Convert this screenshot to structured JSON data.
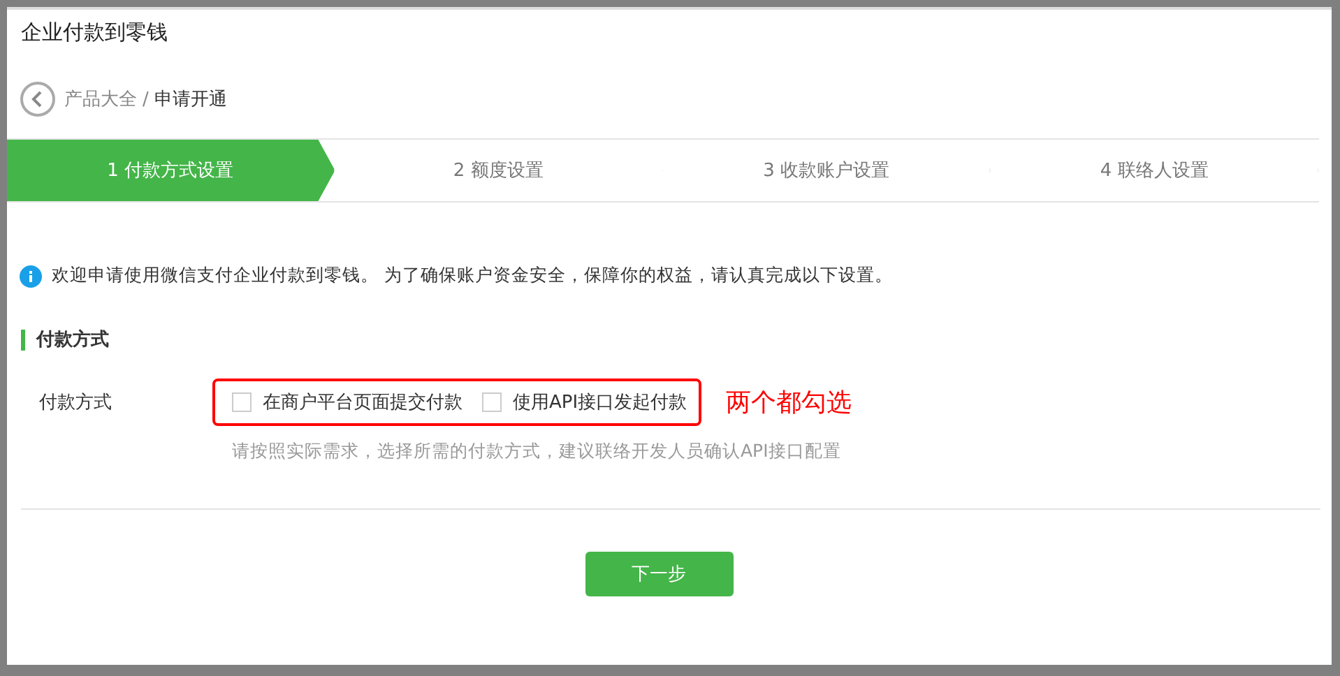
{
  "dialog": {
    "title": "企业付款到零钱"
  },
  "breadcrumb": {
    "parent": "产品大全",
    "separator": "/",
    "current": "申请开通"
  },
  "steps": [
    {
      "label": "1 付款方式设置",
      "selected": true
    },
    {
      "label": "2 额度设置",
      "selected": false
    },
    {
      "label": "3 收款账户设置",
      "selected": false
    },
    {
      "label": "4 联络人设置",
      "selected": false
    }
  ],
  "notice": "欢迎申请使用微信支付企业付款到零钱。 为了确保账户资金安全，保障你的权益，请认真完成以下设置。",
  "section": {
    "title": "付款方式"
  },
  "field": {
    "label": "付款方式",
    "options": [
      {
        "label": "在商户平台页面提交付款",
        "checked": false
      },
      {
        "label": "使用API接口发起付款",
        "checked": false
      }
    ],
    "hint": "请按照实际需求，选择所需的付款方式，建议联络开发人员确认API接口配置"
  },
  "annotation": "两个都勾选",
  "next_button": "下一步"
}
